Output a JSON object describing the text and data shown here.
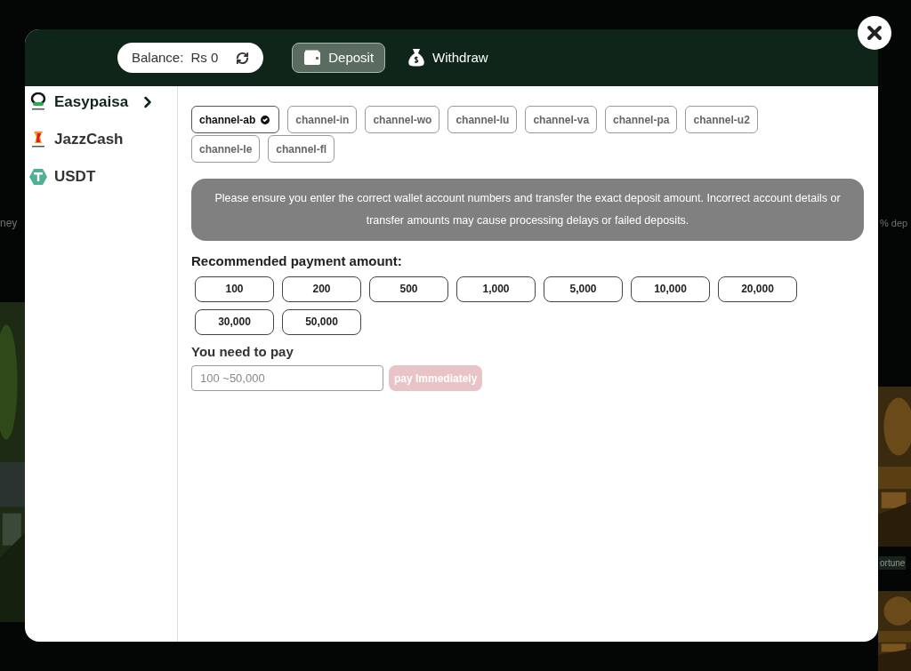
{
  "background": {
    "left_text": "ney",
    "right_text": "% dep",
    "lower_right_text": "ortune"
  },
  "header": {
    "balance_label": "Balance:",
    "balance_value": "Rs 0",
    "tabs": [
      {
        "label": "Deposit",
        "selected": true
      },
      {
        "label": "Withdraw",
        "selected": false
      }
    ]
  },
  "methods": [
    {
      "label": "Easypaisa",
      "selected": true
    },
    {
      "label": "JazzCash",
      "selected": false
    },
    {
      "label": "USDT",
      "selected": false
    }
  ],
  "channels": [
    {
      "label": "channel-ab",
      "selected": true
    },
    {
      "label": "channel-in",
      "selected": false
    },
    {
      "label": "channel-wo",
      "selected": false
    },
    {
      "label": "channel-lu",
      "selected": false
    },
    {
      "label": "channel-va",
      "selected": false
    },
    {
      "label": "channel-pa",
      "selected": false
    },
    {
      "label": "channel-u2",
      "selected": false
    },
    {
      "label": "channel-le",
      "selected": false
    },
    {
      "label": "channel-fl",
      "selected": false
    }
  ],
  "notice": "Please ensure you enter the correct wallet account numbers and transfer the exact deposit amount. Incorrect account details or transfer amounts may cause processing delays or failed deposits.",
  "amounts_label": "Recommended payment amount:",
  "amounts": [
    "100",
    "200",
    "500",
    "1,000",
    "5,000",
    "10,000",
    "20,000",
    "30,000",
    "50,000"
  ],
  "pay_label": "You need to pay",
  "pay_field": {
    "placeholder": "100 ~50,000"
  },
  "pay_button": {
    "label": "pay Immediately",
    "disabled": true
  }
}
